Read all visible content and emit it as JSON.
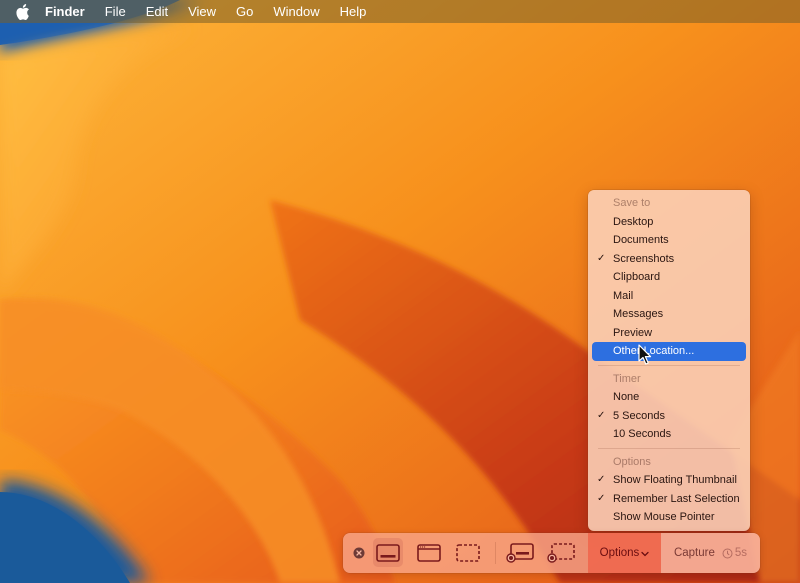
{
  "menubar": {
    "apple_icon": "apple-logo",
    "app_name": "Finder",
    "items": [
      "File",
      "Edit",
      "View",
      "Go",
      "Window",
      "Help"
    ]
  },
  "options_menu": {
    "sections": [
      {
        "header": "Save to",
        "items": [
          {
            "label": "Desktop",
            "checked": false,
            "highlighted": false
          },
          {
            "label": "Documents",
            "checked": false,
            "highlighted": false
          },
          {
            "label": "Screenshots",
            "checked": true,
            "highlighted": false
          },
          {
            "label": "Clipboard",
            "checked": false,
            "highlighted": false
          },
          {
            "label": "Mail",
            "checked": false,
            "highlighted": false
          },
          {
            "label": "Messages",
            "checked": false,
            "highlighted": false
          },
          {
            "label": "Preview",
            "checked": false,
            "highlighted": false
          },
          {
            "label": "Other Location...",
            "checked": false,
            "highlighted": true
          }
        ]
      },
      {
        "header": "Timer",
        "items": [
          {
            "label": "None",
            "checked": false,
            "highlighted": false
          },
          {
            "label": "5 Seconds",
            "checked": true,
            "highlighted": false
          },
          {
            "label": "10 Seconds",
            "checked": false,
            "highlighted": false
          }
        ]
      },
      {
        "header": "Options",
        "items": [
          {
            "label": "Show Floating Thumbnail",
            "checked": true,
            "highlighted": false
          },
          {
            "label": "Remember Last Selection",
            "checked": true,
            "highlighted": false
          },
          {
            "label": "Show Mouse Pointer",
            "checked": false,
            "highlighted": false
          }
        ]
      }
    ],
    "check_glyph": "✓"
  },
  "toolbar": {
    "close_icon": "close-circle",
    "modes": [
      {
        "name": "capture-entire-screen",
        "icon": "screen-icon",
        "active": true
      },
      {
        "name": "capture-selected-window",
        "icon": "window-icon",
        "active": false
      },
      {
        "name": "capture-selected-portion",
        "icon": "dashed-rect-icon",
        "active": false
      },
      {
        "name": "record-entire-screen",
        "icon": "record-screen-icon",
        "active": false
      },
      {
        "name": "record-selected-portion",
        "icon": "record-portion-icon",
        "active": false
      }
    ],
    "options_label": "Options",
    "options_chevron": "⌄",
    "capture_label": "Capture",
    "timer_value": "5s"
  },
  "colors": {
    "highlight": "#2d6fe0",
    "toolbar_icon": "#7a1a1c",
    "options_text": "#6a0d10"
  }
}
